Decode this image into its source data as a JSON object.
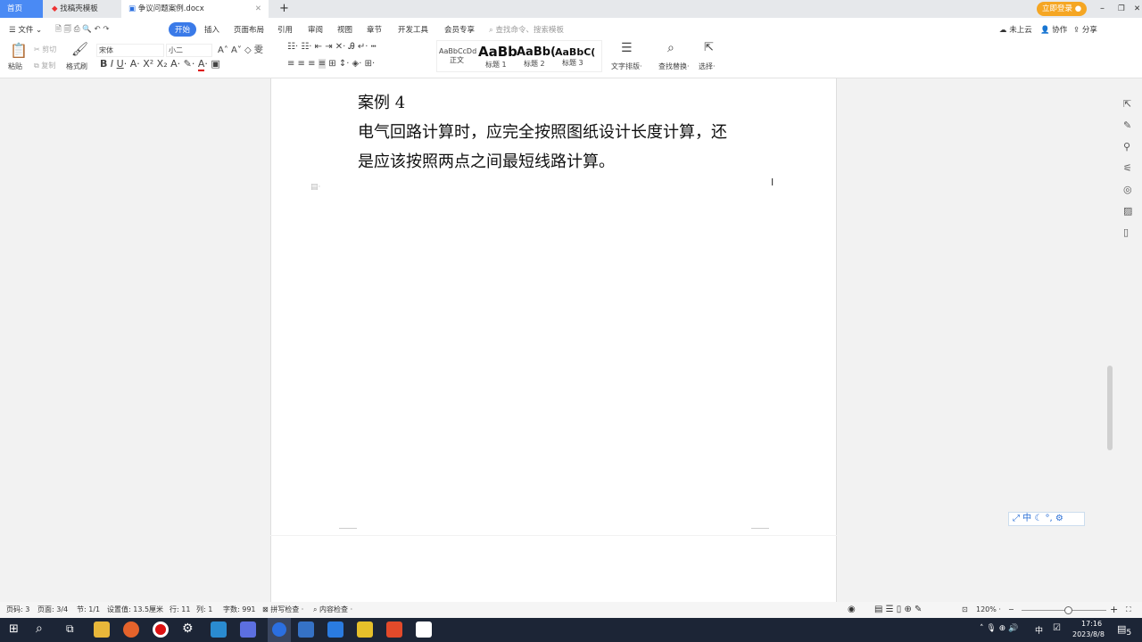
{
  "tabs": [
    {
      "label": "首页"
    },
    {
      "label": "找稿壳模板"
    },
    {
      "label": "争议问题案例.docx"
    }
  ],
  "title_bar": {
    "login": "立即登录"
  },
  "menu": [
    "文件",
    "开始",
    "插入",
    "页面布局",
    "引用",
    "审阅",
    "视图",
    "章节",
    "开发工具",
    "会员专享"
  ],
  "search_placeholder": "查找命令、搜索模板",
  "right_actions": [
    "未上云",
    "协作",
    "分享"
  ],
  "toolbar": {
    "paste": "粘贴",
    "cut": "剪切",
    "copy": "复制",
    "format_painter": "格式刷",
    "font": "宋体",
    "size": "小二",
    "text_layout": "文字排版",
    "find_replace": "查找替换",
    "select": "选择"
  },
  "styles": [
    {
      "preview": "AaBbCcDd",
      "label": "正文"
    },
    {
      "preview": "AaBb",
      "label": "标题 1"
    },
    {
      "preview": "AaBb(",
      "label": "标题 2"
    },
    {
      "preview": "AaBbC(",
      "label": "标题 3"
    }
  ],
  "document": {
    "heading": "案例 4",
    "line1": "电气回路计算时，应完全按照图纸设计长度计算，还",
    "line2": "是应该按照两点之间最短线路计算。"
  },
  "status": {
    "page_num": "页码: 3",
    "pages": "页面: 3/4",
    "section": "节: 1/1",
    "setting": "设置值: 13.5厘米",
    "row": "行: 11",
    "col": "列: 1",
    "words": "字数: 991",
    "spell": "拼写检查",
    "content": "内容检查",
    "zoom": "120%",
    "zoom_fraction": 0.5
  },
  "taskbar": {
    "time": "17:16",
    "date": "2023/8/8",
    "ime": "中",
    "notifications": "5"
  }
}
